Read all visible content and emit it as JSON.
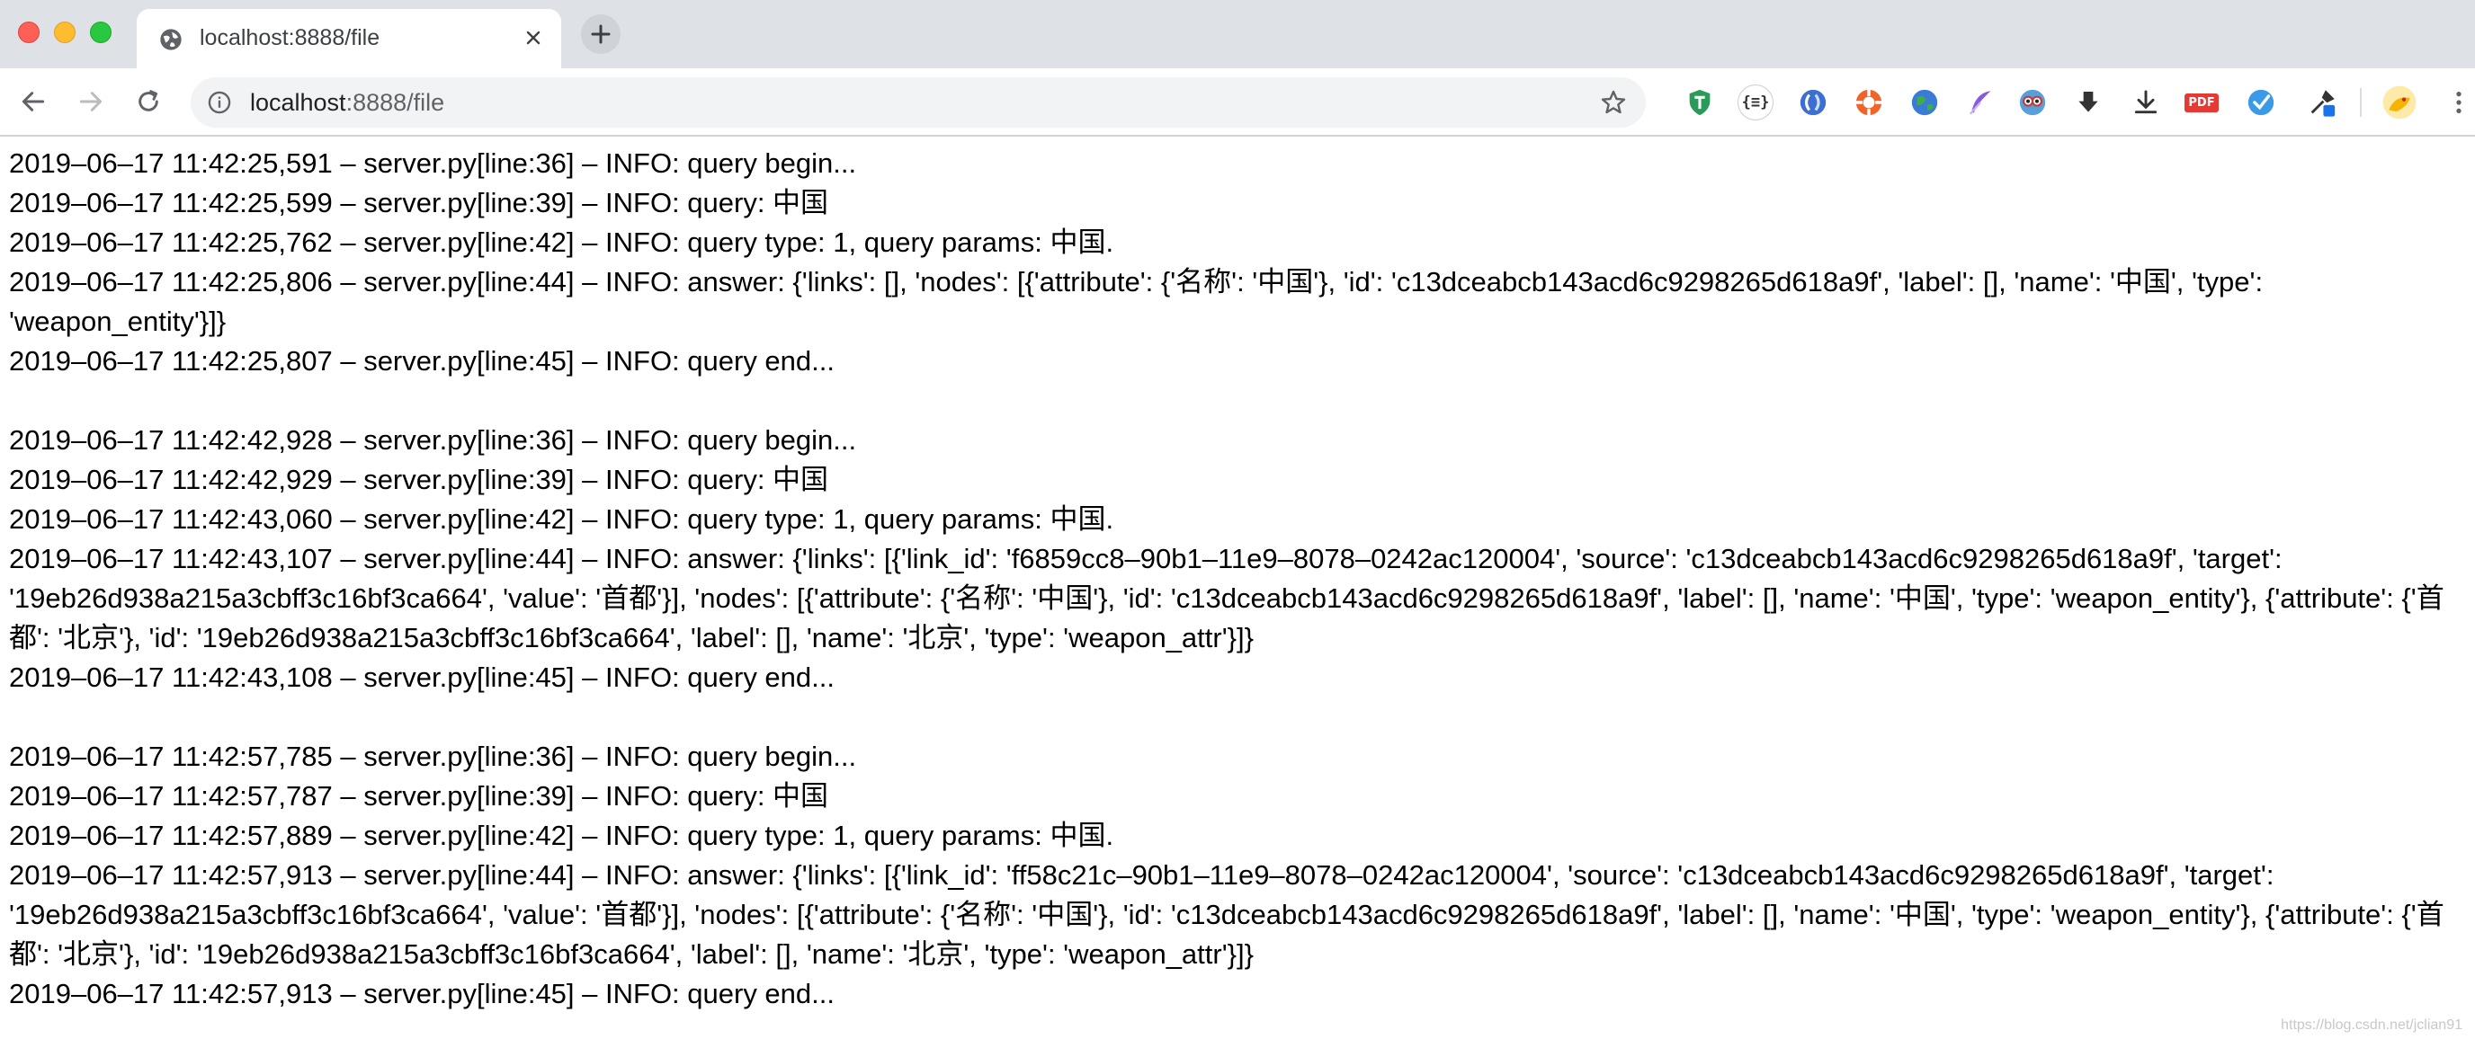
{
  "tab": {
    "title": "localhost:8888/file"
  },
  "address": {
    "host": "localhost",
    "path": ":8888/file"
  },
  "extensions": [
    {
      "name": "shield-extension-icon",
      "color": "#2a9a58"
    },
    {
      "name": "json-extension-icon",
      "label": "{≡}",
      "color": "#333333"
    },
    {
      "name": "shortcut-extension-icon",
      "color": "#3c6fd1"
    },
    {
      "name": "lifesaver-extension-icon",
      "color": "#f0642a"
    },
    {
      "name": "globe-extension-icon",
      "color": "#3a7bd5"
    },
    {
      "name": "feather-extension-icon",
      "color": "#8a5bd6"
    },
    {
      "name": "owl-extension-icon",
      "color": "#c83a3a"
    },
    {
      "name": "download-solid-icon",
      "color": "#333333"
    },
    {
      "name": "download-line-icon",
      "color": "#333333"
    },
    {
      "name": "pdf-extension-icon",
      "label": "PDF",
      "color": "#e53935"
    },
    {
      "name": "check-circle-extension-icon",
      "color": "#3a9ae8"
    },
    {
      "name": "eyedropper-extension-icon",
      "color": "#1a73e8"
    },
    {
      "name": "profile-avatar-icon",
      "color": "#f4b400"
    },
    {
      "name": "menu-more-icon",
      "color": "#5f6368"
    }
  ],
  "log_groups": [
    [
      "2019–06–17 11:42:25,591 – server.py[line:36] – INFO: query begin...",
      "2019–06–17 11:42:25,599 – server.py[line:39] – INFO: query: 中国",
      "2019–06–17 11:42:25,762 – server.py[line:42] – INFO: query type: 1, query params: 中国.",
      "2019–06–17 11:42:25,806 – server.py[line:44] – INFO: answer: {'links': [], 'nodes': [{'attribute': {'名称': '中国'}, 'id': 'c13dceabcb143acd6c9298265d618a9f', 'label': [], 'name': '中国', 'type': 'weapon_entity'}]}",
      "2019–06–17 11:42:25,807 – server.py[line:45] – INFO: query end..."
    ],
    [
      "2019–06–17 11:42:42,928 – server.py[line:36] – INFO: query begin...",
      "2019–06–17 11:42:42,929 – server.py[line:39] – INFO: query: 中国",
      "2019–06–17 11:42:43,060 – server.py[line:42] – INFO: query type: 1, query params: 中国.",
      "2019–06–17 11:42:43,107 – server.py[line:44] – INFO: answer: {'links': [{'link_id': 'f6859cc8–90b1–11e9–8078–0242ac120004', 'source': 'c13dceabcb143acd6c9298265d618a9f', 'target': '19eb26d938a215a3cbff3c16bf3ca664', 'value': '首都'}], 'nodes': [{'attribute': {'名称': '中国'}, 'id': 'c13dceabcb143acd6c9298265d618a9f', 'label': [], 'name': '中国', 'type': 'weapon_entity'}, {'attribute': {'首都': '北京'}, 'id': '19eb26d938a215a3cbff3c16bf3ca664', 'label': [], 'name': '北京', 'type': 'weapon_attr'}]}",
      "2019–06–17 11:42:43,108 – server.py[line:45] – INFO: query end..."
    ],
    [
      "2019–06–17 11:42:57,785 – server.py[line:36] – INFO: query begin...",
      "2019–06–17 11:42:57,787 – server.py[line:39] – INFO: query: 中国",
      "2019–06–17 11:42:57,889 – server.py[line:42] – INFO: query type: 1, query params: 中国.",
      "2019–06–17 11:42:57,913 – server.py[line:44] – INFO: answer: {'links': [{'link_id': 'ff58c21c–90b1–11e9–8078–0242ac120004', 'source': 'c13dceabcb143acd6c9298265d618a9f', 'target': '19eb26d938a215a3cbff3c16bf3ca664', 'value': '首都'}], 'nodes': [{'attribute': {'名称': '中国'}, 'id': 'c13dceabcb143acd6c9298265d618a9f', 'label': [], 'name': '中国', 'type': 'weapon_entity'}, {'attribute': {'首都': '北京'}, 'id': '19eb26d938a215a3cbff3c16bf3ca664', 'label': [], 'name': '北京', 'type': 'weapon_attr'}]}",
      "2019–06–17 11:42:57,913 – server.py[line:45] – INFO: query end..."
    ]
  ],
  "watermark": "https://blog.csdn.net/jclian91"
}
